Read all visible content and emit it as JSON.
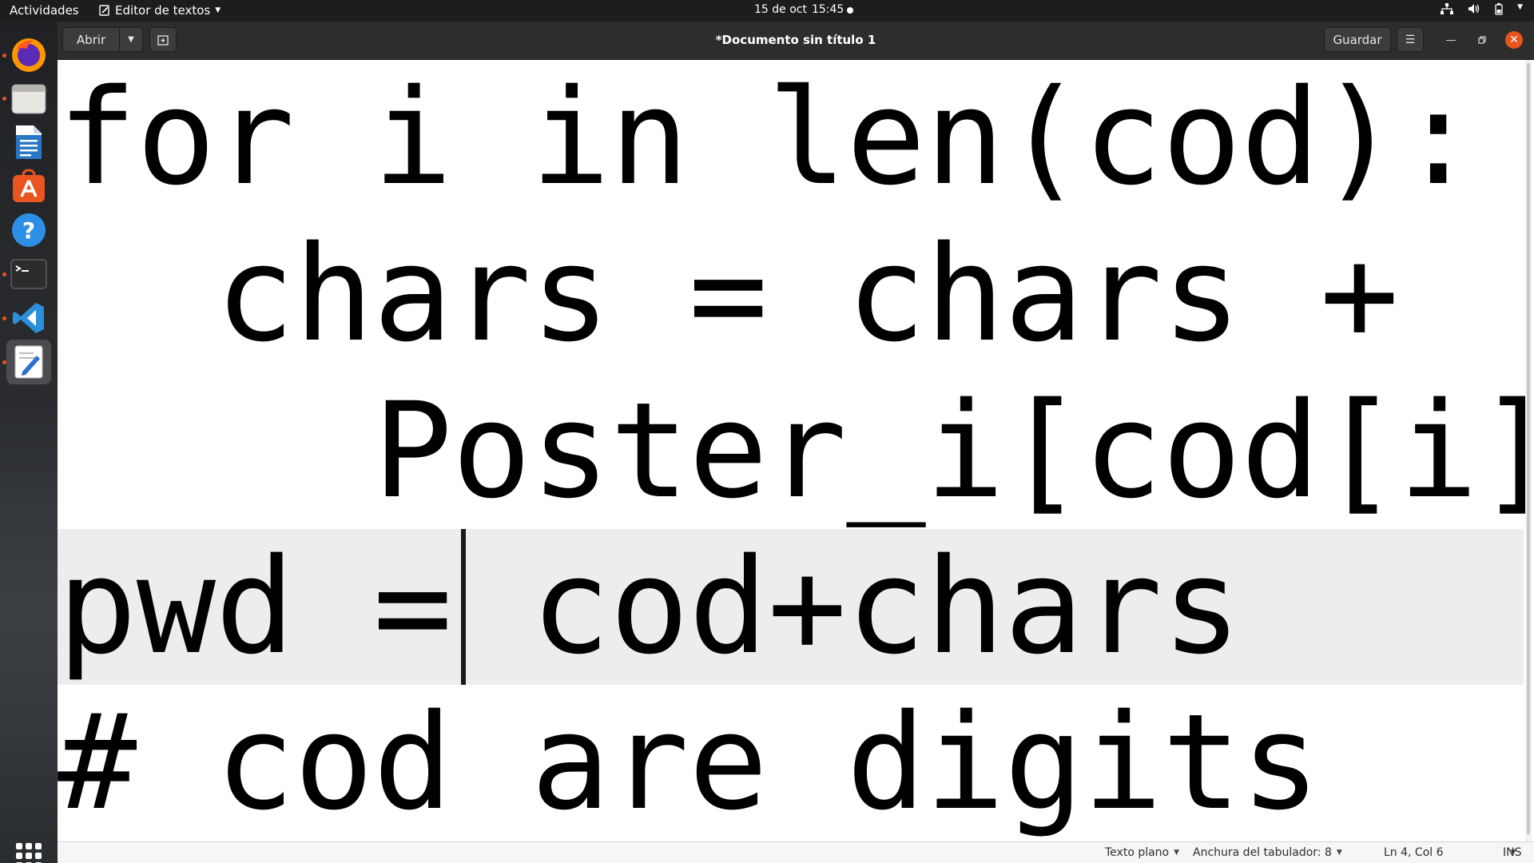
{
  "topbar": {
    "activities": "Actividades",
    "app_menu": "Editor de textos",
    "date": "15 de oct",
    "time": "15:45"
  },
  "dock": {
    "items": [
      {
        "name": "firefox-icon",
        "active": false
      },
      {
        "name": "files-icon",
        "active": false
      },
      {
        "name": "libreoffice-writer-icon",
        "active": false
      },
      {
        "name": "ubuntu-software-icon",
        "active": false
      },
      {
        "name": "help-icon",
        "active": false
      },
      {
        "name": "terminal-icon",
        "active": false
      },
      {
        "name": "vscode-icon",
        "active": false
      },
      {
        "name": "text-editor-icon",
        "active": true
      }
    ]
  },
  "window": {
    "open_label": "Abrir",
    "title": "*Documento sin título 1",
    "save_label": "Guardar"
  },
  "editor": {
    "lines": [
      "for i in len(cod):",
      "  chars = chars +",
      "    Poster_i[cod[i]]",
      "pwd = cod+chars",
      "# cod are digits"
    ],
    "cursor_line": 4,
    "cursor_col": 6
  },
  "statusbar": {
    "language": "Texto plano",
    "tab_width": "Anchura del tabulador: 8",
    "position": "Ln 4, Col 6",
    "mode": "INS"
  },
  "colors": {
    "accent": "#e95420",
    "topbar_bg": "#1d1d1d",
    "headerbar_bg": "#2d2d2d",
    "current_line_bg": "#ededed"
  }
}
